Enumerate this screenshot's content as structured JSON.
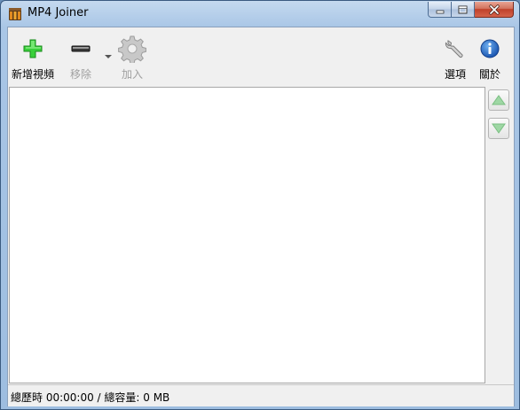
{
  "window": {
    "title": "MP4 Joiner",
    "accent_close": "#c8442c"
  },
  "toolbar": {
    "add_video_label": "新增視頻",
    "remove_label": "移除",
    "join_label": "加入",
    "options_label": "選項",
    "about_label": "關於"
  },
  "icons": {
    "add": "plus-icon",
    "remove": "minus-icon",
    "join": "gear-icon",
    "options": "wrench-icon",
    "about": "info-icon",
    "move_up": "triangle-up-icon",
    "move_down": "triangle-down-icon"
  },
  "status": {
    "text": "總歷時 00:00:00 / 總容量: 0 MB"
  }
}
